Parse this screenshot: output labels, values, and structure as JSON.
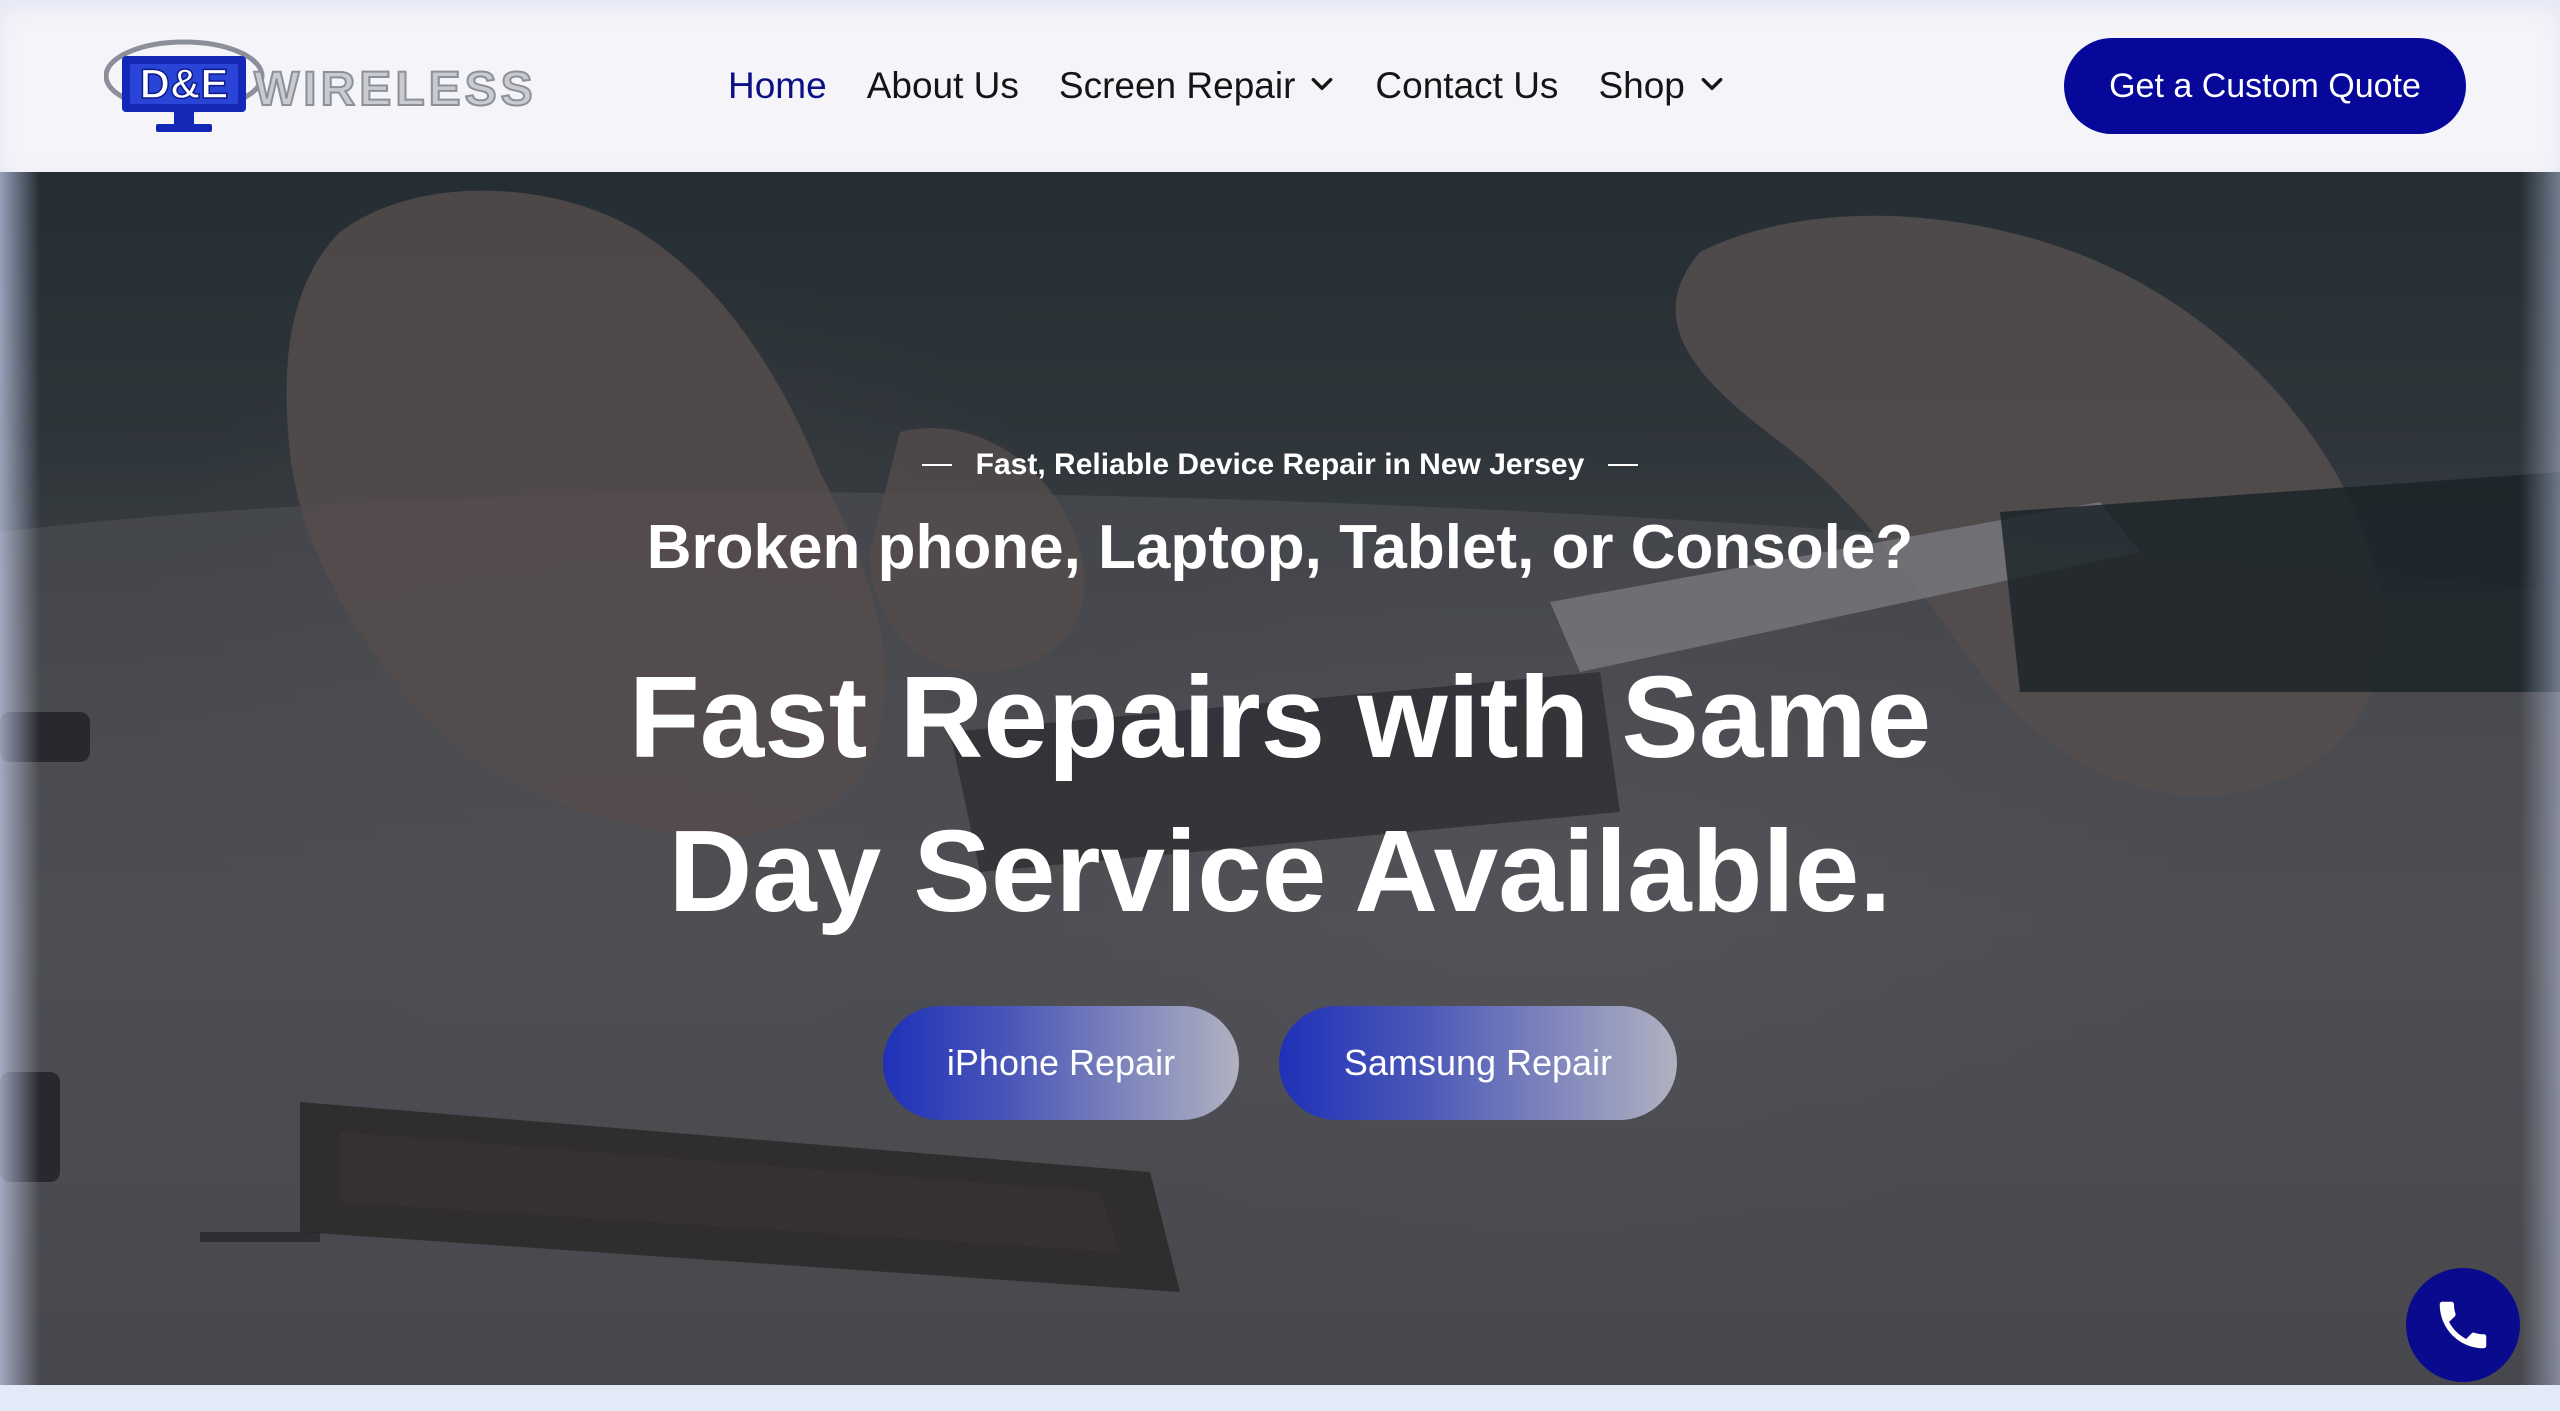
{
  "header": {
    "logo_alt": "D&E Wireless",
    "logo_text": "WIRELESS",
    "cta_label": "Get a Custom Quote"
  },
  "nav": {
    "items": [
      {
        "label": "Home",
        "active": true,
        "has_dropdown": false
      },
      {
        "label": "About Us",
        "active": false,
        "has_dropdown": false
      },
      {
        "label": "Screen Repair",
        "active": false,
        "has_dropdown": true
      },
      {
        "label": "Contact Us",
        "active": false,
        "has_dropdown": false
      },
      {
        "label": "Shop",
        "active": false,
        "has_dropdown": true
      }
    ]
  },
  "hero": {
    "eyebrow": "Fast, Reliable Device Repair in New Jersey",
    "subheadline": "Broken phone, Laptop, Tablet, or Console?",
    "headline_line1": "Fast Repairs with Same",
    "headline_line2": "Day Service Available.",
    "buttons": [
      {
        "label": "iPhone Repair"
      },
      {
        "label": "Samsung Repair"
      }
    ]
  },
  "floating": {
    "call_icon": "phone-icon"
  },
  "colors": {
    "brand_navy": "#07089a",
    "active_nav": "#0a0f86",
    "header_bg": "#f5f4f9"
  }
}
